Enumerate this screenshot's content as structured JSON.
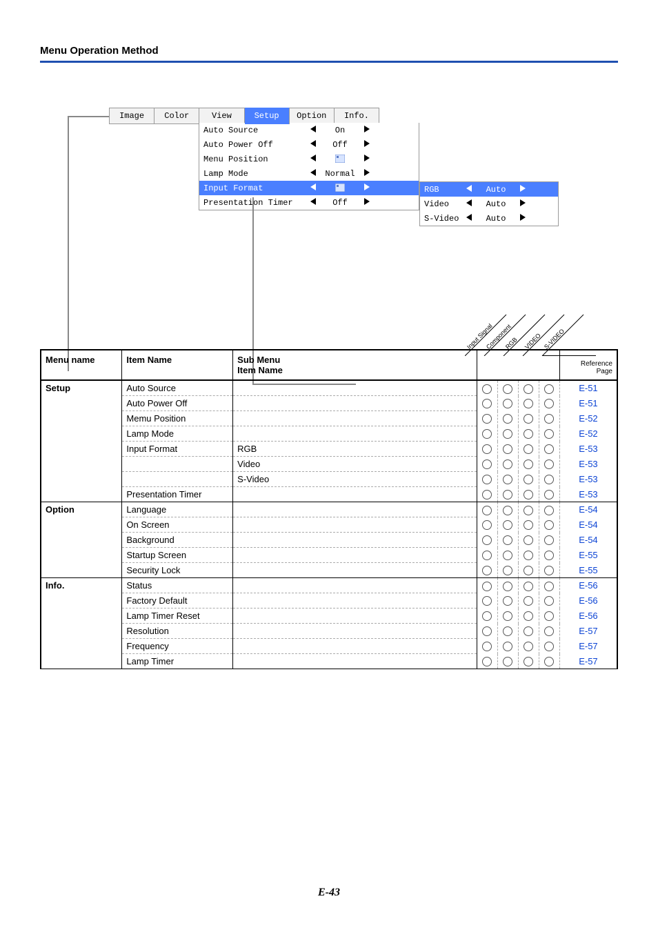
{
  "header": {
    "title": "Menu Operation Method"
  },
  "osd": {
    "tabs": [
      "Image",
      "Color",
      "View",
      "Setup",
      "Option",
      "Info."
    ],
    "selected_tab": "Setup",
    "rows": [
      {
        "label": "Auto Source",
        "value": "On",
        "selected": false,
        "icon": false
      },
      {
        "label": "Auto Power Off",
        "value": "Off",
        "selected": false,
        "icon": false
      },
      {
        "label": "Menu Position",
        "value": "",
        "selected": false,
        "icon": true
      },
      {
        "label": "Lamp Mode",
        "value": "Normal",
        "selected": false,
        "icon": false
      },
      {
        "label": "Input Format",
        "value": "",
        "selected": true,
        "icon": true
      },
      {
        "label": "Presentation Timer",
        "value": "Off",
        "selected": false,
        "icon": false
      }
    ],
    "sub": [
      {
        "label": "RGB",
        "value": "Auto",
        "selected": true
      },
      {
        "label": "Video",
        "value": "Auto",
        "selected": false
      },
      {
        "label": "S-Video",
        "value": "Auto",
        "selected": false
      }
    ]
  },
  "table": {
    "col_headers": {
      "menu": "Menu name",
      "item": "Item Name",
      "sub": "Sub Menu\nItem Name",
      "ref": "Reference\nPage"
    },
    "signal_headers": [
      "Input Signal",
      "Component",
      "RGB",
      "VIDEO",
      "S-VIDEO"
    ],
    "groups": [
      {
        "menu": "Setup",
        "rows": [
          {
            "item": "Auto Source",
            "sub": "",
            "sig": [
              1,
              1,
              1,
              1
            ],
            "ref": "E-51"
          },
          {
            "item": "Auto Power Off",
            "sub": "",
            "sig": [
              1,
              1,
              1,
              1
            ],
            "ref": "E-51"
          },
          {
            "item": "Memu Position",
            "sub": "",
            "sig": [
              1,
              1,
              1,
              1
            ],
            "ref": "E-52"
          },
          {
            "item": "Lamp Mode",
            "sub": "",
            "sig": [
              1,
              1,
              1,
              1
            ],
            "ref": "E-52"
          },
          {
            "item": "Input Format",
            "sub": "RGB",
            "sig": [
              1,
              1,
              1,
              1
            ],
            "ref": "E-53"
          },
          {
            "item": "",
            "sub": "Video",
            "sig": [
              1,
              1,
              1,
              1
            ],
            "ref": "E-53"
          },
          {
            "item": "",
            "sub": "S-Video",
            "sig": [
              1,
              1,
              1,
              1
            ],
            "ref": "E-53"
          },
          {
            "item": "Presentation Timer",
            "sub": "",
            "sig": [
              1,
              1,
              1,
              1
            ],
            "ref": "E-53"
          }
        ]
      },
      {
        "menu": "Option",
        "rows": [
          {
            "item": "Language",
            "sub": "",
            "sig": [
              1,
              1,
              1,
              1
            ],
            "ref": "E-54"
          },
          {
            "item": "On Screen",
            "sub": "",
            "sig": [
              1,
              1,
              1,
              1
            ],
            "ref": "E-54"
          },
          {
            "item": "Background",
            "sub": "",
            "sig": [
              1,
              1,
              1,
              1
            ],
            "ref": "E-54"
          },
          {
            "item": "Startup Screen",
            "sub": "",
            "sig": [
              1,
              1,
              1,
              1
            ],
            "ref": "E-55"
          },
          {
            "item": "Security Lock",
            "sub": "",
            "sig": [
              1,
              1,
              1,
              1
            ],
            "ref": "E-55"
          }
        ]
      },
      {
        "menu": "Info.",
        "rows": [
          {
            "item": "Status",
            "sub": "",
            "sig": [
              1,
              1,
              1,
              1
            ],
            "ref": "E-56"
          },
          {
            "item": "Factory Default",
            "sub": "",
            "sig": [
              1,
              1,
              1,
              1
            ],
            "ref": "E-56"
          },
          {
            "item": "Lamp Timer Reset",
            "sub": "",
            "sig": [
              1,
              1,
              1,
              1
            ],
            "ref": "E-56"
          },
          {
            "item": "Resolution",
            "sub": "",
            "sig": [
              1,
              1,
              1,
              1
            ],
            "ref": "E-57"
          },
          {
            "item": "Frequency",
            "sub": "",
            "sig": [
              1,
              1,
              1,
              1
            ],
            "ref": "E-57"
          },
          {
            "item": "Lamp Timer",
            "sub": "",
            "sig": [
              1,
              1,
              1,
              1
            ],
            "ref": "E-57"
          }
        ]
      }
    ]
  },
  "footer": {
    "page_number": "E-43"
  }
}
